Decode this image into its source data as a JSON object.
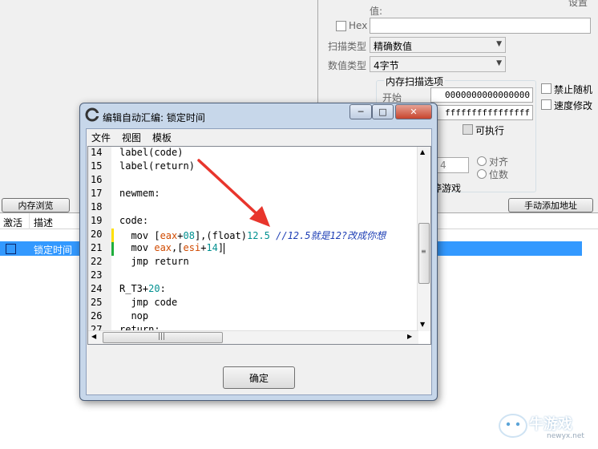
{
  "main": {
    "right_cut_label": "设置",
    "value_label": "值:",
    "hex_label": "Hex",
    "scan_type_label": "扫描类型",
    "scan_type_value": "精确数值",
    "value_type_label": "数值类型",
    "value_type_value": "4字节",
    "mem_scan_group": "内存扫描选项",
    "start_label": "开始",
    "start_value": "0000000000000000",
    "stop_value": "ffffffffffffffff",
    "executable_label": "可执行",
    "align_label": "对齐",
    "bits_label": "位数",
    "align_value": "4",
    "pause_game_label": "暂停游戏",
    "disable_random_label": "禁止随机",
    "speed_modify_label": "速度修改",
    "mem_browse_button": "内存浏览",
    "manual_add_button": "手动添加地址",
    "columns": [
      "激活",
      "描述"
    ],
    "rows": [
      {
        "active": false,
        "description": "锁定时间"
      }
    ]
  },
  "dialog": {
    "title": "编辑自动汇编: 锁定时间",
    "menu": [
      "文件",
      "视图",
      "模板"
    ],
    "confirm_button": "确定",
    "window_buttons": {
      "minimize": "─",
      "maximize": "□",
      "close": "✕"
    }
  },
  "code_lines": [
    {
      "n": "14",
      "parts": [
        {
          "t": "label(code)",
          "c": "kw"
        }
      ]
    },
    {
      "n": "15",
      "parts": [
        {
          "t": "label(return)",
          "c": "kw"
        }
      ]
    },
    {
      "n": "16",
      "parts": []
    },
    {
      "n": "17",
      "parts": [
        {
          "t": "newmem:",
          "c": "kw"
        }
      ]
    },
    {
      "n": "18",
      "parts": []
    },
    {
      "n": "19",
      "parts": [
        {
          "t": "code:",
          "c": "kw"
        }
      ]
    },
    {
      "n": "20",
      "parts": [
        {
          "t": "  mov [",
          "c": "kw"
        },
        {
          "t": "eax",
          "c": "reg"
        },
        {
          "t": "+",
          "c": "kw"
        },
        {
          "t": "08",
          "c": "num"
        },
        {
          "t": "],(float)",
          "c": "kw"
        },
        {
          "t": "12.5",
          "c": "num"
        },
        {
          "t": " //12.5就是12?改成你想",
          "c": "cmt"
        }
      ]
    },
    {
      "n": "21",
      "parts": [
        {
          "t": "  mov ",
          "c": "kw"
        },
        {
          "t": "eax",
          "c": "reg"
        },
        {
          "t": ",[",
          "c": "kw"
        },
        {
          "t": "esi",
          "c": "reg"
        },
        {
          "t": "+",
          "c": "kw"
        },
        {
          "t": "14",
          "c": "num"
        },
        {
          "t": "]",
          "c": "kw"
        }
      ]
    },
    {
      "n": "22",
      "parts": [
        {
          "t": "  jmp return",
          "c": "kw"
        }
      ]
    },
    {
      "n": "23",
      "parts": []
    },
    {
      "n": "24",
      "parts": [
        {
          "t": "R_T3+",
          "c": "kw"
        },
        {
          "t": "20",
          "c": "num"
        },
        {
          "t": ":",
          "c": "kw"
        }
      ]
    },
    {
      "n": "25",
      "parts": [
        {
          "t": "  jmp code",
          "c": "kw"
        }
      ]
    },
    {
      "n": "26",
      "parts": [
        {
          "t": "  nop",
          "c": "kw"
        }
      ]
    },
    {
      "n": "27",
      "parts": [
        {
          "t": "return:",
          "c": "kw"
        }
      ]
    }
  ],
  "watermark": {
    "brand": "牛游戏",
    "site": "newyx.net"
  }
}
